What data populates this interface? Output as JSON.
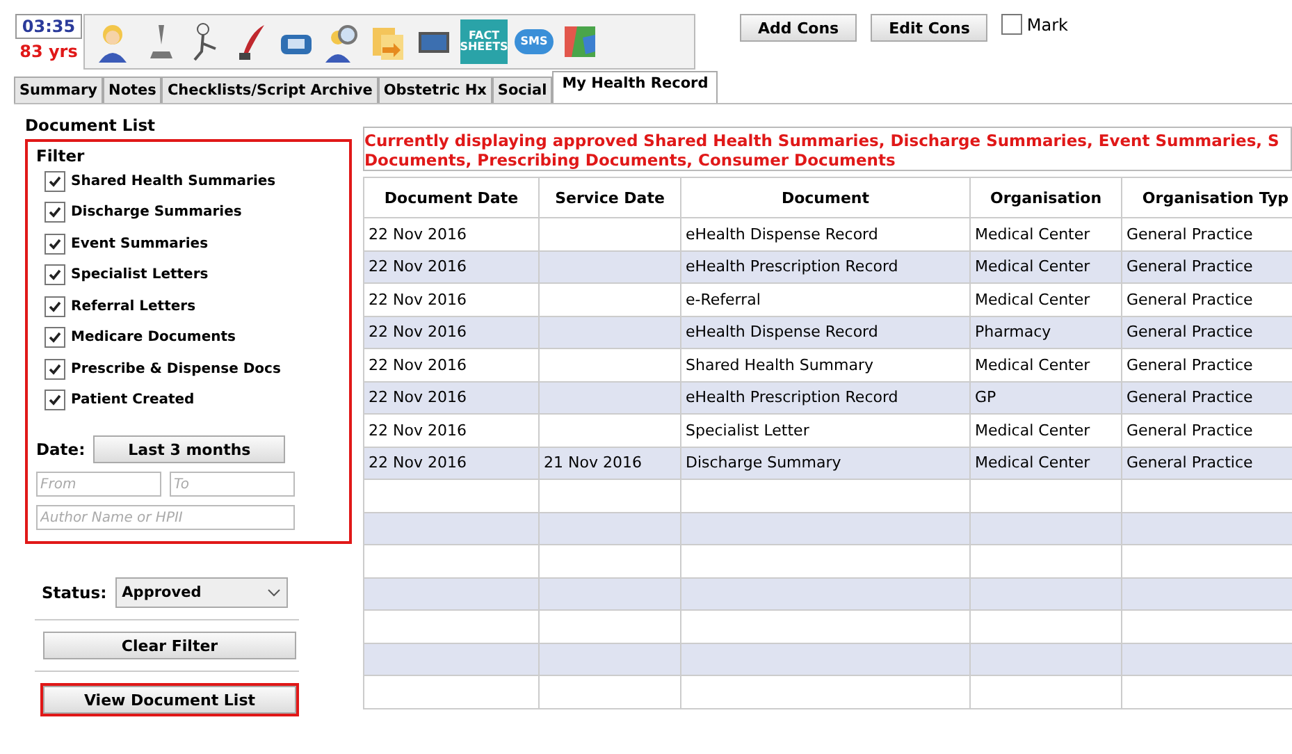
{
  "header": {
    "time": "03:35",
    "age": "83 yrs",
    "toolbar_badges": [
      {
        "kind": "fact",
        "label": "FACT SHEETS"
      },
      {
        "kind": "sms",
        "label": "SMS"
      }
    ],
    "buttons": [
      "Add Cons",
      "Edit Cons"
    ],
    "mark": {
      "label": "Mark",
      "checked": false
    }
  },
  "tabs": [
    {
      "label": "Summary",
      "selected": false
    },
    {
      "label": "Notes",
      "selected": false
    },
    {
      "label": "Checklists/Script Archive",
      "selected": false
    },
    {
      "label": "Obstetric Hx",
      "selected": false
    },
    {
      "label": "Social",
      "selected": false
    },
    {
      "label": "My Health Record",
      "selected": true
    }
  ],
  "document_list": {
    "title": "Document List",
    "filter": {
      "title": "Filter",
      "options": [
        {
          "label": "Shared Health Summaries",
          "checked": true
        },
        {
          "label": "Discharge Summaries",
          "checked": true
        },
        {
          "label": "Event Summaries",
          "checked": true
        },
        {
          "label": "Specialist Letters",
          "checked": true
        },
        {
          "label": "Referral Letters",
          "checked": true
        },
        {
          "label": "Medicare Documents",
          "checked": true
        },
        {
          "label": "Prescribe & Dispense Docs",
          "checked": true
        },
        {
          "label": "Patient Created",
          "checked": true
        }
      ],
      "date_label": "Date:",
      "date_button": "Last 3 months",
      "from_placeholder": "From",
      "to_placeholder": "To",
      "author_placeholder": "Author Name or HPII"
    },
    "status_label": "Status:",
    "status_value": "Approved",
    "clear_button": "Clear Filter",
    "view_button": "View Document List"
  },
  "message": [
    "Currently displaying approved Shared Health Summaries, Discharge Summaries, Event Summaries, S",
    "Documents, Prescribing Documents, Consumer Documents"
  ],
  "table": {
    "columns": [
      "Document Date",
      "Service Date",
      "Document",
      "Organisation",
      "Organisation Typ"
    ],
    "rows": [
      [
        "22 Nov 2016",
        "",
        "eHealth Dispense Record",
        "Medical Center",
        "General Practice"
      ],
      [
        "22 Nov 2016",
        "",
        "eHealth Prescription Record",
        "Medical Center",
        "General Practice"
      ],
      [
        "22 Nov 2016",
        "",
        "e-Referral",
        "Medical Center",
        "General Practice"
      ],
      [
        "22 Nov 2016",
        "",
        "eHealth Dispense Record",
        "Pharmacy",
        "General Practice"
      ],
      [
        "22 Nov 2016",
        "",
        "Shared Health Summary",
        "Medical Center",
        "General Practice"
      ],
      [
        "22 Nov 2016",
        "",
        "eHealth Prescription Record",
        "GP",
        "General Practice"
      ],
      [
        "22 Nov 2016",
        "",
        "Specialist Letter",
        "Medical Center",
        "General Practice"
      ],
      [
        "22 Nov 2016",
        "21 Nov 2016",
        "Discharge Summary",
        "Medical Center",
        "General Practice"
      ]
    ]
  }
}
